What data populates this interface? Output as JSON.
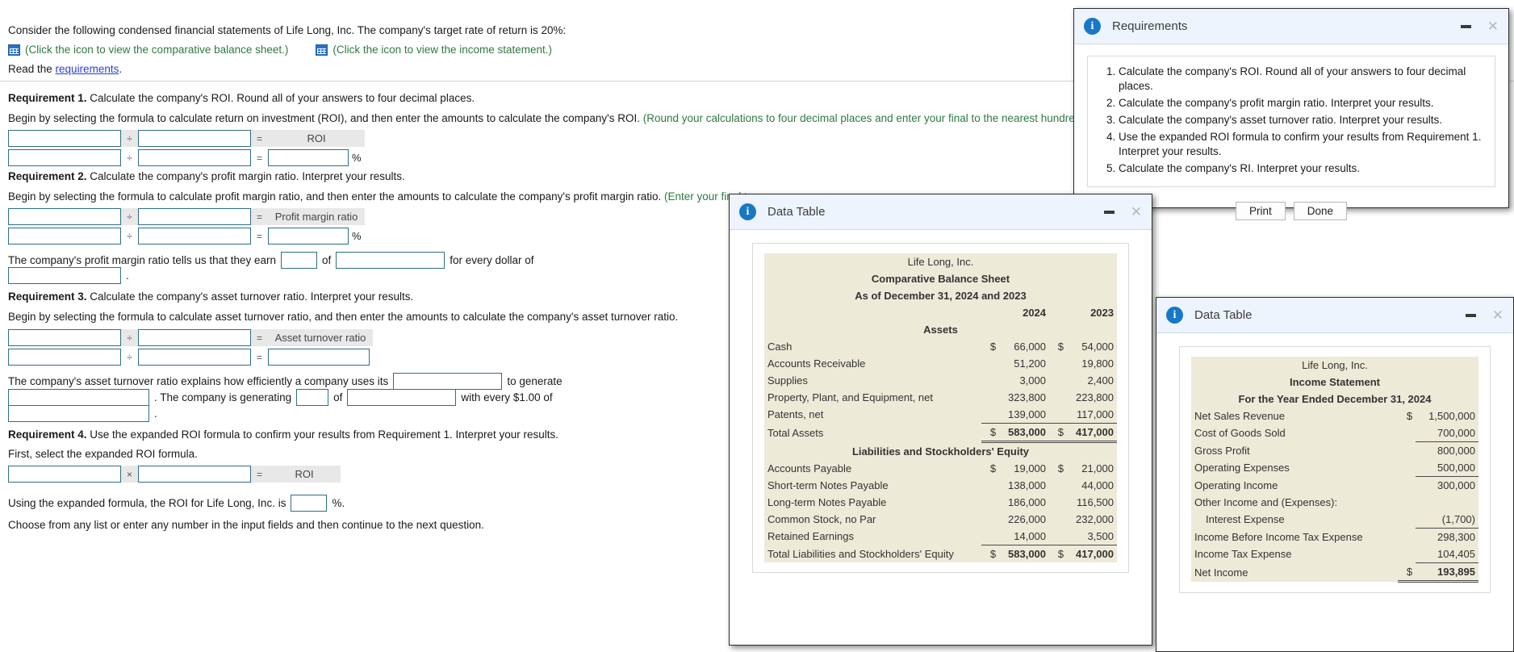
{
  "worksheet": {
    "intro_line": "Consider the following condensed financial statements of Life Long, Inc. The company's target rate of return is 20%:",
    "balance_sheet_link": "(Click the icon to view the comparative balance sheet.)",
    "income_statement_link": "(Click the icon to view the income statement.)",
    "read_prefix": "Read the ",
    "read_link": "requirements",
    "read_suffix": ".",
    "requirement1": {
      "head_bold": "Requirement 1.",
      "head_rest": " Calculate the company's ROI. Round all of your answers to four decimal places.",
      "instruction": "Begin by selecting the formula to calculate return on investment (ROI), and then enter the amounts to calculate the company's ROI. ",
      "instruction_green": "(Round your calculations to four decimal places and enter your final to the nearest hundredth of a p",
      "operator": "÷",
      "equals": "=",
      "result_label": "ROI",
      "percent": "%"
    },
    "requirement2": {
      "head_bold": "Requirement 2.",
      "head_rest": " Calculate the company's profit margin ratio. Interpret your results.",
      "instruction": "Begin by selecting the formula to calculate profit margin ratio, and then enter the amounts to calculate the company's profit margin ratio. ",
      "instruction_green": "(Enter your final to",
      "operator": "÷",
      "equals": "=",
      "result_label": "Profit margin ratio",
      "percent": "%",
      "interpret_a": "The company's profit margin ratio tells us that they earn",
      "interpret_b": "of",
      "interpret_c": "for every dollar of",
      "interpret_d": "."
    },
    "requirement3": {
      "head_bold": "Requirement 3.",
      "head_rest": " Calculate the company's asset turnover ratio. Interpret your results.",
      "instruction": "Begin by selecting the formula to calculate asset turnover ratio, and then enter the amounts to calculate the company's asset turnover ratio.",
      "operator": "÷",
      "equals": "=",
      "result_label": "Asset turnover ratio",
      "interpret_a": "The company's asset turnover ratio explains how efficiently a company uses its",
      "interpret_b": "to generate",
      "interpret_c": ". The company is generating",
      "interpret_d": "of",
      "interpret_e": "with every $1.00 of",
      "interpret_f": "."
    },
    "requirement4": {
      "head_bold": "Requirement 4.",
      "head_rest": " Use the expanded ROI formula to confirm your results from Requirement 1. Interpret your results.",
      "instruction": "First, select the expanded ROI formula.",
      "operator": "×",
      "equals": "=",
      "result_label": "ROI",
      "interpret_a": "Using the expanded formula, the ROI for Life Long, Inc. is",
      "interpret_b": "%."
    },
    "footer": "Choose from any list or enter any number in the input fields and then continue to the next question."
  },
  "requirements_dialog": {
    "title": "Requirements",
    "items": [
      "Calculate the company's ROI. Round all of your answers to four decimal places.",
      "Calculate the company's profit margin ratio. Interpret your results.",
      "Calculate the company's asset turnover ratio. Interpret your results.",
      "Use the expanded ROI formula to confirm your results from Requirement 1. Interpret your results.",
      "Calculate the company's RI. Interpret your results."
    ],
    "print_label": "Print",
    "done_label": "Done",
    "minimize_icon": "minimize-icon",
    "close_icon": "close-icon"
  },
  "balance_sheet_dialog": {
    "title": "Data Table",
    "company": "Life Long, Inc.",
    "statement": "Comparative Balance Sheet",
    "period": "As of December 31, 2024 and 2023",
    "col_2024": "2024",
    "col_2023": "2023",
    "assets_header": "Assets",
    "liab_header": "Liabilities and Stockholders' Equity",
    "rows_assets": [
      {
        "label": "Cash",
        "cur1": "$",
        "v2024": "66,000",
        "cur2": "$",
        "v2023": "54,000"
      },
      {
        "label": "Accounts Receivable",
        "cur1": "",
        "v2024": "51,200",
        "cur2": "",
        "v2023": "19,800"
      },
      {
        "label": "Supplies",
        "cur1": "",
        "v2024": "3,000",
        "cur2": "",
        "v2023": "2,400"
      },
      {
        "label": "Property, Plant, and Equipment, net",
        "cur1": "",
        "v2024": "323,800",
        "cur2": "",
        "v2023": "223,800"
      },
      {
        "label": "Patents, net",
        "cur1": "",
        "v2024": "139,000",
        "cur2": "",
        "v2023": "117,000"
      },
      {
        "label": "Total Assets",
        "cur1": "$",
        "v2024": "583,000",
        "cur2": "$",
        "v2023": "417,000"
      }
    ],
    "rows_liab": [
      {
        "label": "Accounts Payable",
        "cur1": "$",
        "v2024": "19,000",
        "cur2": "$",
        "v2023": "21,000"
      },
      {
        "label": "Short-term Notes Payable",
        "cur1": "",
        "v2024": "138,000",
        "cur2": "",
        "v2023": "44,000"
      },
      {
        "label": "Long-term Notes Payable",
        "cur1": "",
        "v2024": "186,000",
        "cur2": "",
        "v2023": "116,500"
      },
      {
        "label": "Common Stock, no Par",
        "cur1": "",
        "v2024": "226,000",
        "cur2": "",
        "v2023": "232,000"
      },
      {
        "label": "Retained Earnings",
        "cur1": "",
        "v2024": "14,000",
        "cur2": "",
        "v2023": "3,500"
      },
      {
        "label": "Total Liabilities and Stockholders' Equity",
        "cur1": "$",
        "v2024": "583,000",
        "cur2": "$",
        "v2023": "417,000"
      }
    ],
    "minimize_icon": "minimize-icon",
    "close_icon": "close-icon"
  },
  "income_statement_dialog": {
    "title": "Data Table",
    "company": "Life Long, Inc.",
    "statement": "Income Statement",
    "period": "For the Year Ended December 31, 2024",
    "rows": [
      {
        "label": "Net Sales Revenue",
        "cur": "$",
        "value": "1,500,000",
        "indent": false,
        "rule": ""
      },
      {
        "label": "Cost of Goods Sold",
        "cur": "",
        "value": "700,000",
        "indent": false,
        "rule": "under"
      },
      {
        "label": "Gross Profit",
        "cur": "",
        "value": "800,000",
        "indent": false,
        "rule": ""
      },
      {
        "label": "Operating Expenses",
        "cur": "",
        "value": "500,000",
        "indent": false,
        "rule": "under"
      },
      {
        "label": "Operating Income",
        "cur": "",
        "value": "300,000",
        "indent": false,
        "rule": ""
      },
      {
        "label": "Other Income and (Expenses):",
        "cur": "",
        "value": "",
        "indent": false,
        "rule": ""
      },
      {
        "label": "Interest Expense",
        "cur": "",
        "value": "(1,700)",
        "indent": true,
        "rule": "under"
      },
      {
        "label": "Income Before Income Tax Expense",
        "cur": "",
        "value": "298,300",
        "indent": false,
        "rule": ""
      },
      {
        "label": "Income Tax Expense",
        "cur": "",
        "value": "104,405",
        "indent": false,
        "rule": "under"
      },
      {
        "label": "Net Income",
        "cur": "$",
        "value": "193,895",
        "indent": false,
        "rule": "double"
      }
    ],
    "minimize_icon": "minimize-icon",
    "close_icon": "close-icon"
  },
  "colors": {
    "link_green": "#2f7a3f",
    "link_blue": "#2a3fd0",
    "input_border": "#2d6e87",
    "dialog_header": "#eef4fd",
    "table_header_band": "#c8c3ac",
    "table_body": "#eeead8",
    "info_icon": "#1878c8"
  }
}
